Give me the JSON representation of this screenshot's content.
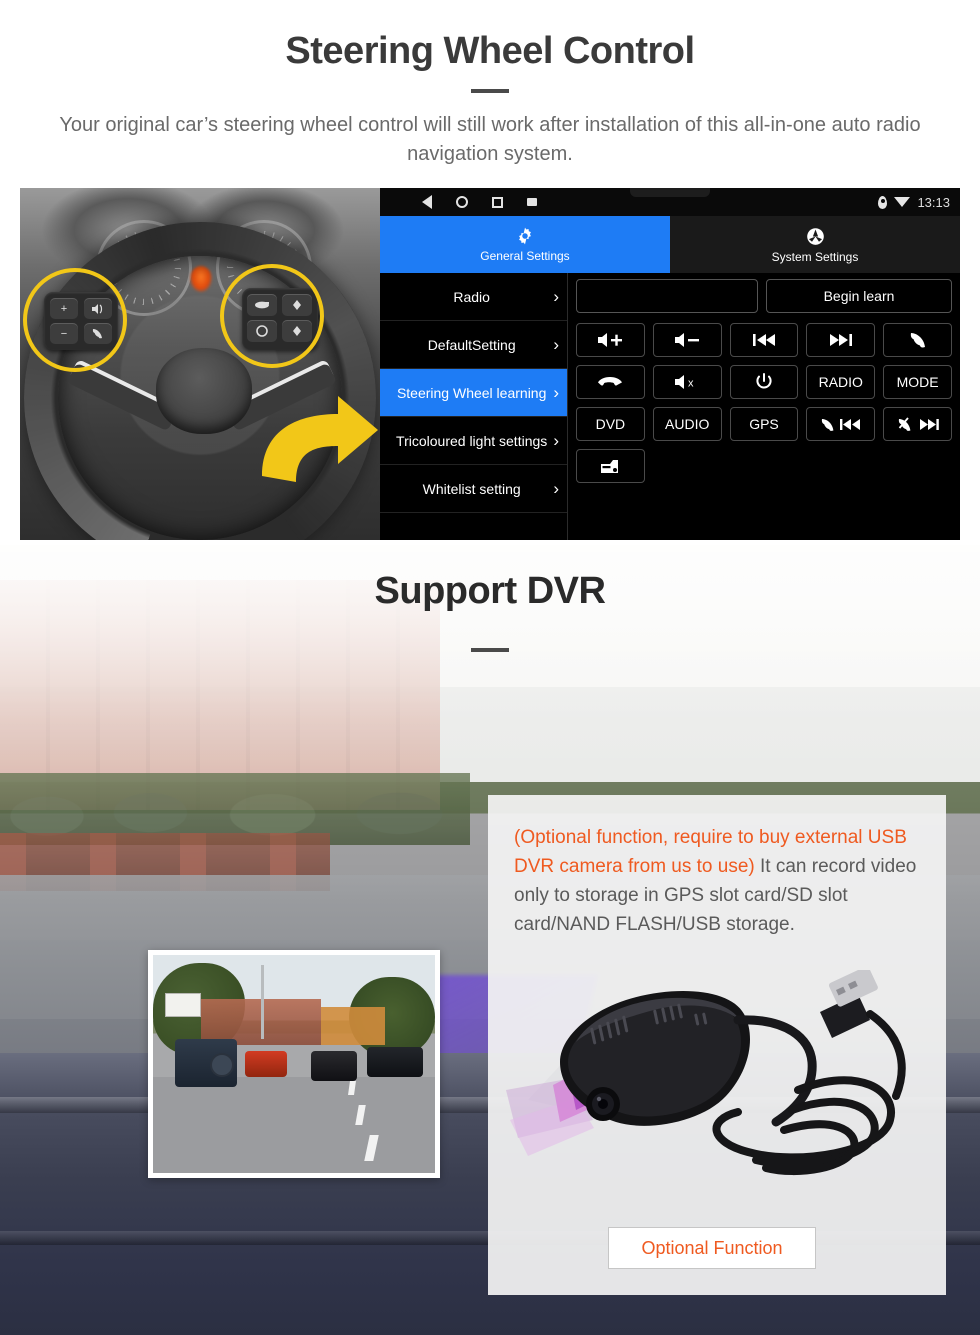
{
  "section1": {
    "title": "Steering Wheel Control",
    "subtitle": "Your original car’s steering wheel control will still work after installation of this all-in-one auto radio navigation system.",
    "unit": {
      "status": {
        "time": "13:13",
        "icons": [
          "back-triangle",
          "home-circle",
          "recents-square",
          "screenshot",
          "location-pin",
          "wifi"
        ]
      },
      "tabs": [
        {
          "label": "General Settings",
          "icon": "gear-icon",
          "active": true
        },
        {
          "label": "System Settings",
          "icon": "system-icon",
          "active": false
        }
      ],
      "menu": [
        {
          "label": "Radio",
          "selected": false
        },
        {
          "label": "DefaultSetting",
          "selected": false
        },
        {
          "label": "Steering Wheel learning",
          "selected": true
        },
        {
          "label": "Tricoloured light settings",
          "selected": false
        },
        {
          "label": "Whitelist setting",
          "selected": false
        }
      ],
      "input_value": "",
      "begin_learn_label": "Begin learn",
      "buttons": [
        {
          "label": "",
          "icon": "volume-up-icon"
        },
        {
          "label": "",
          "icon": "volume-down-icon"
        },
        {
          "label": "",
          "icon": "previous-track-icon"
        },
        {
          "label": "",
          "icon": "next-track-icon"
        },
        {
          "label": "",
          "icon": "phone-answer-icon"
        },
        {
          "label": "",
          "icon": "phone-hangup-icon"
        },
        {
          "label": "",
          "icon": "mute-icon"
        },
        {
          "label": "",
          "icon": "power-icon"
        },
        {
          "label": "RADIO",
          "icon": ""
        },
        {
          "label": "MODE",
          "icon": ""
        },
        {
          "label": "DVD",
          "icon": ""
        },
        {
          "label": "AUDIO",
          "icon": ""
        },
        {
          "label": "GPS",
          "icon": ""
        },
        {
          "label": "",
          "icon": "phone-previous-icon"
        },
        {
          "label": "",
          "icon": "phone-reject-next-icon"
        },
        {
          "label": "",
          "icon": "car-icon"
        }
      ]
    },
    "photo": {
      "caption": "steering-wheel-photo",
      "highlight_color": "#f2c718",
      "arrow_color": "#f2c718"
    }
  },
  "section2": {
    "title": "Support DVR",
    "card": {
      "highlight_text": "(Optional function, require to buy external USB DVR camera from us to use)",
      "body_text": "It can record video only to storage in GPS slot card/SD slot card/NAND FLASH/USB storage.",
      "button_label": "Optional Function",
      "device_caption": "usb-dvr-camera"
    },
    "inset_caption": "dashcam-recording-preview"
  },
  "colors": {
    "accent_blue": "#1e7cf5",
    "accent_orange": "#ef5a20",
    "highlight_yellow": "#f2c718",
    "heading": "#3a3a3a",
    "body_text": "#6a6a6a"
  }
}
